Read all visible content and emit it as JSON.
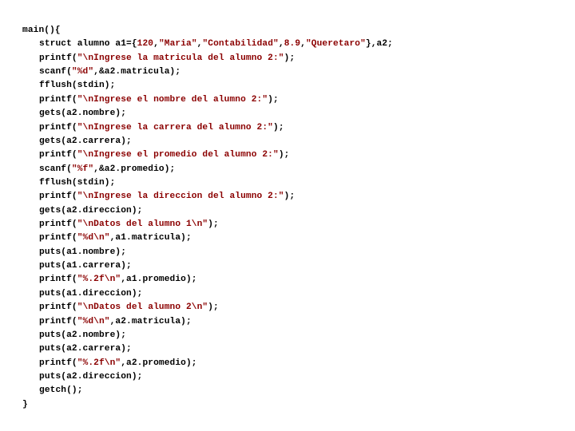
{
  "code": {
    "lines": [
      {
        "indent": 0,
        "parts": [
          {
            "t": "kw",
            "v": "main"
          },
          {
            "t": "id",
            "v": "(){"
          }
        ]
      },
      {
        "indent": 1,
        "parts": [
          {
            "t": "kw",
            "v": "struct alumno "
          },
          {
            "t": "id",
            "v": "a1={"
          },
          {
            "t": "num",
            "v": "120"
          },
          {
            "t": "id",
            "v": ","
          },
          {
            "t": "str",
            "v": "\"Maria\""
          },
          {
            "t": "id",
            "v": ","
          },
          {
            "t": "str",
            "v": "\"Contabilidad\""
          },
          {
            "t": "id",
            "v": ","
          },
          {
            "t": "num",
            "v": "8.9"
          },
          {
            "t": "id",
            "v": ","
          },
          {
            "t": "str",
            "v": "\"Queretaro\""
          },
          {
            "t": "id",
            "v": "},a2;"
          }
        ]
      },
      {
        "indent": 1,
        "parts": [
          {
            "t": "id",
            "v": "printf("
          },
          {
            "t": "str",
            "v": "\"\\nIngrese la matricula del alumno 2:\""
          },
          {
            "t": "id",
            "v": ");"
          }
        ]
      },
      {
        "indent": 1,
        "parts": [
          {
            "t": "id",
            "v": "scanf("
          },
          {
            "t": "str",
            "v": "\"%d\""
          },
          {
            "t": "id",
            "v": ",&a2.matricula);"
          }
        ]
      },
      {
        "indent": 1,
        "parts": [
          {
            "t": "id",
            "v": "fflush(stdin);"
          }
        ]
      },
      {
        "indent": 1,
        "parts": [
          {
            "t": "id",
            "v": "printf("
          },
          {
            "t": "str",
            "v": "\"\\nIngrese el nombre del alumno 2:\""
          },
          {
            "t": "id",
            "v": ");"
          }
        ]
      },
      {
        "indent": 1,
        "parts": [
          {
            "t": "id",
            "v": "gets(a2.nombre);"
          }
        ]
      },
      {
        "indent": 1,
        "parts": [
          {
            "t": "id",
            "v": "printf("
          },
          {
            "t": "str",
            "v": "\"\\nIngrese la carrera del alumno 2:\""
          },
          {
            "t": "id",
            "v": ");"
          }
        ]
      },
      {
        "indent": 1,
        "parts": [
          {
            "t": "id",
            "v": "gets(a2.carrera);"
          }
        ]
      },
      {
        "indent": 1,
        "parts": [
          {
            "t": "id",
            "v": "printf("
          },
          {
            "t": "str",
            "v": "\"\\nIngrese el promedio del alumno 2:\""
          },
          {
            "t": "id",
            "v": ");"
          }
        ]
      },
      {
        "indent": 1,
        "parts": [
          {
            "t": "id",
            "v": "scanf("
          },
          {
            "t": "str",
            "v": "\"%f\""
          },
          {
            "t": "id",
            "v": ",&a2.promedio);"
          }
        ]
      },
      {
        "indent": 1,
        "parts": [
          {
            "t": "id",
            "v": "fflush(stdin);"
          }
        ]
      },
      {
        "indent": 1,
        "parts": [
          {
            "t": "id",
            "v": "printf("
          },
          {
            "t": "str",
            "v": "\"\\nIngrese la direccion del alumno 2:\""
          },
          {
            "t": "id",
            "v": ");"
          }
        ]
      },
      {
        "indent": 1,
        "parts": [
          {
            "t": "id",
            "v": "gets(a2.direccion);"
          }
        ]
      },
      {
        "indent": 1,
        "parts": [
          {
            "t": "id",
            "v": "printf("
          },
          {
            "t": "str",
            "v": "\"\\nDatos del alumno 1\\n\""
          },
          {
            "t": "id",
            "v": ");"
          }
        ]
      },
      {
        "indent": 1,
        "parts": [
          {
            "t": "id",
            "v": "printf("
          },
          {
            "t": "str",
            "v": "\"%d\\n\""
          },
          {
            "t": "id",
            "v": ",a1.matricula);"
          }
        ]
      },
      {
        "indent": 1,
        "parts": [
          {
            "t": "id",
            "v": "puts(a1.nombre);"
          }
        ]
      },
      {
        "indent": 1,
        "parts": [
          {
            "t": "id",
            "v": "puts(a1.carrera);"
          }
        ]
      },
      {
        "indent": 1,
        "parts": [
          {
            "t": "id",
            "v": "printf("
          },
          {
            "t": "str",
            "v": "\"%.2f\\n\""
          },
          {
            "t": "id",
            "v": ",a1.promedio);"
          }
        ]
      },
      {
        "indent": 1,
        "parts": [
          {
            "t": "id",
            "v": "puts(a1.direccion);"
          }
        ]
      },
      {
        "indent": 1,
        "parts": [
          {
            "t": "id",
            "v": "printf("
          },
          {
            "t": "str",
            "v": "\"\\nDatos del alumno 2\\n\""
          },
          {
            "t": "id",
            "v": ");"
          }
        ]
      },
      {
        "indent": 1,
        "parts": [
          {
            "t": "id",
            "v": "printf("
          },
          {
            "t": "str",
            "v": "\"%d\\n\""
          },
          {
            "t": "id",
            "v": ",a2.matricula);"
          }
        ]
      },
      {
        "indent": 1,
        "parts": [
          {
            "t": "id",
            "v": "puts(a2.nombre);"
          }
        ]
      },
      {
        "indent": 1,
        "parts": [
          {
            "t": "id",
            "v": "puts(a2.carrera);"
          }
        ]
      },
      {
        "indent": 1,
        "parts": [
          {
            "t": "id",
            "v": "printf("
          },
          {
            "t": "str",
            "v": "\"%.2f\\n\""
          },
          {
            "t": "id",
            "v": ",a2.promedio);"
          }
        ]
      },
      {
        "indent": 1,
        "parts": [
          {
            "t": "id",
            "v": "puts(a2.direccion);"
          }
        ]
      },
      {
        "indent": 1,
        "parts": [
          {
            "t": "id",
            "v": "getch();"
          }
        ]
      },
      {
        "indent": 0,
        "parts": [
          {
            "t": "id",
            "v": "}"
          }
        ]
      }
    ]
  }
}
